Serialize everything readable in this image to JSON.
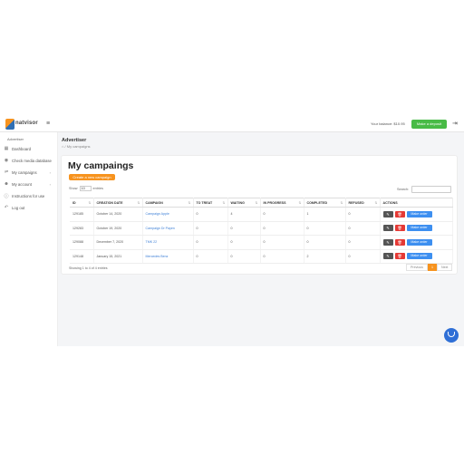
{
  "header": {
    "logo_text": "natvisor",
    "balance_text": "Your balance: $10.95",
    "deposit_label": "Make a deposit"
  },
  "sidebar": {
    "section": "Advertiser",
    "items": [
      {
        "label": "Dashboard",
        "icon": "grid-icon"
      },
      {
        "label": "Check media database",
        "icon": "database-icon"
      },
      {
        "label": "My campaigns",
        "icon": "campaigns-icon"
      },
      {
        "label": "My account",
        "icon": "user-icon"
      },
      {
        "label": "Instructions for use",
        "icon": "info-icon"
      },
      {
        "label": "Log out",
        "icon": "logout-icon"
      }
    ]
  },
  "page": {
    "title": "Advertiser",
    "breadcrumb": "My campaigns"
  },
  "card": {
    "title": "My campaings",
    "create_label": "Create a new campaign",
    "show_label": "Show",
    "show_value": "10",
    "entries_label": "entries",
    "search_label": "Search:"
  },
  "table": {
    "columns": [
      "ID",
      "CREATION DATE",
      "CAMPAIGN",
      "TO TREAT",
      "WAITING",
      "IN PROGRESS",
      "COMPLETED",
      "REFUSED",
      "ACTIONS"
    ],
    "rows": [
      {
        "id": "129185",
        "date": "October 14, 2020",
        "campaign": "Campaign Apple",
        "to_treat": "0",
        "waiting": "4",
        "in_progress": "0",
        "completed": "1",
        "refused": "0",
        "order_label": "Make order"
      },
      {
        "id": "129283",
        "date": "October 19, 2020",
        "campaign": "Campaign Dr Payen",
        "to_treat": "0",
        "waiting": "0",
        "in_progress": "0",
        "completed": "0",
        "refused": "0",
        "order_label": "Make order"
      },
      {
        "id": "129088",
        "date": "December 7, 2020",
        "campaign": "TMK 22",
        "to_treat": "0",
        "waiting": "0",
        "in_progress": "0",
        "completed": "0",
        "refused": "0",
        "order_label": "Make order"
      },
      {
        "id": "129148",
        "date": "January 15, 2021",
        "campaign": "Mercedes Benz",
        "to_treat": "0",
        "waiting": "0",
        "in_progress": "0",
        "completed": "2",
        "refused": "0",
        "order_label": "Make order"
      }
    ]
  },
  "footer": {
    "showing": "Showing 1 to 4 of 4 entries",
    "prev": "Previous",
    "page": "1",
    "next": "Next"
  },
  "colors": {
    "accent": "#f7931e",
    "deposit": "#48bb46",
    "order": "#3d8ff0",
    "delete": "#e53935",
    "chat": "#2f6fd6"
  }
}
